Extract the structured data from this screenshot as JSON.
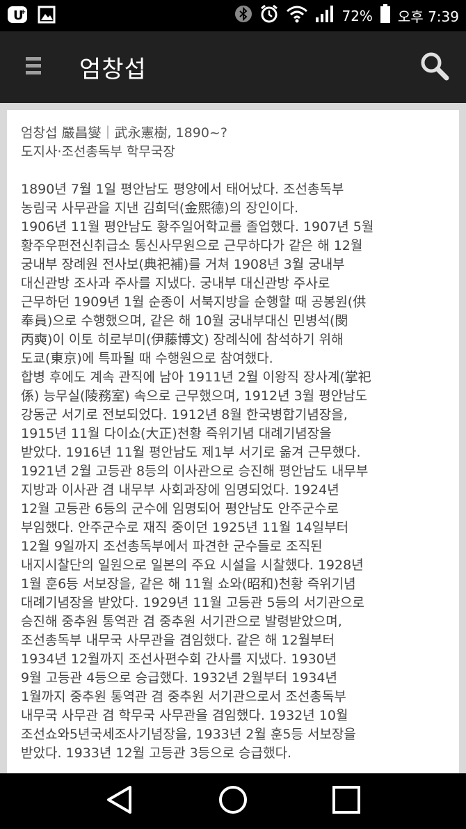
{
  "status_bar": {
    "battery_percent": "72%",
    "time": "오후 7:39",
    "icons": [
      "u-plus-icon",
      "gallery-icon",
      "bluetooth-icon",
      "alarm-icon",
      "wifi-icon",
      "signal-icon",
      "battery-icon"
    ]
  },
  "app_bar": {
    "title": "엄창섭"
  },
  "article": {
    "header_lines": [
      "엄창섭 嚴昌燮｜武永憲樹, 1890~?",
      "도지사·조선총독부 학무국장"
    ],
    "body_lines": [
      "1890년 7월 1일 평안남도 평양에서 태어났다. 조선총독부",
      "농림국 사무관을 지낸 김희덕(金熙德)의 장인이다.",
      "1906년 11월 평안남도 황주일어학교를 졸업했다. 1907년 5월",
      "황주우편전신취급소 통신사무원으로 근무하다가 같은 해 12월",
      "궁내부 장례원 전사보(典祀補)를 거쳐 1908년 3월 궁내부",
      "대신관방 조사과 주사를 지냈다. 궁내부 대신관방 주사로",
      "근무하던 1909년 1월 순종이 서북지방을 순행할 때 공봉원(供",
      "奉員)으로 수행했으며, 같은 해 10월 궁내부대신 민병석(閔",
      "丙奭)이 이토 히로부미(伊藤博文) 장례식에 참석하기 위해",
      "도쿄(東京)에 특파될 때 수행원으로 참여했다.",
      "합병 후에도 계속 관직에 남아 1911년 2월 이왕직 장사계(掌祀",
      "係) 능무실(陵務室) 속으로 근무했으며, 1912년 3월 평안남도",
      "강동군 서기로 전보되었다. 1912년 8월 한국병합기념장을,",
      "1915년 11월 다이쇼(大正)천황 즉위기념 대례기념장을",
      "받았다. 1916년 11월 평안남도 제1부 서기로 옮겨 근무했다.",
      "1921년 2월 고등관 8등의 이사관으로 승진해 평안남도 내무부",
      "지방과 이사관 겸 내무부 사회과장에 임명되었다. 1924년",
      "12월 고등관 6등의 군수에 임명되어 평안남도 안주군수로",
      "부임했다. 안주군수로 재직 중이던 1925년 11월 14일부터",
      "12월 9일까지 조선총독부에서 파견한 군수들로 조직된",
      "내지시찰단의 일원으로 일본의 주요 시설을 시찰했다. 1928년",
      "1월 훈6등 서보장을, 같은 해 11월 쇼와(昭和)천황 즉위기념",
      "대례기념장을 받았다. 1929년 11월 고등관 5등의 서기관으로",
      "승진해 중추원 통역관 겸 중추원 서기관으로 발령받았으며,",
      "조선총독부 내무국 사무관을 겸임했다. 같은 해 12월부터",
      "1934년 12월까지 조선사편수회 간사를 지냈다. 1930년",
      "9월 고등관 4등으로 승급했다. 1932년 2월부터 1934년",
      "1월까지 중추원 통역관 겸 중추원 서기관으로서 조선총독부",
      "내무국 사무관 겸 학무국 사무관을 겸임했다. 1932년 10월",
      "조선쇼와5년국세조사기념장을, 1933년 2월 훈5등 서보장을",
      "받았다. 1933년 12월 고등관 3등으로 승급했다."
    ]
  },
  "nav_bar": {
    "buttons": [
      "back",
      "home",
      "recents"
    ]
  }
}
